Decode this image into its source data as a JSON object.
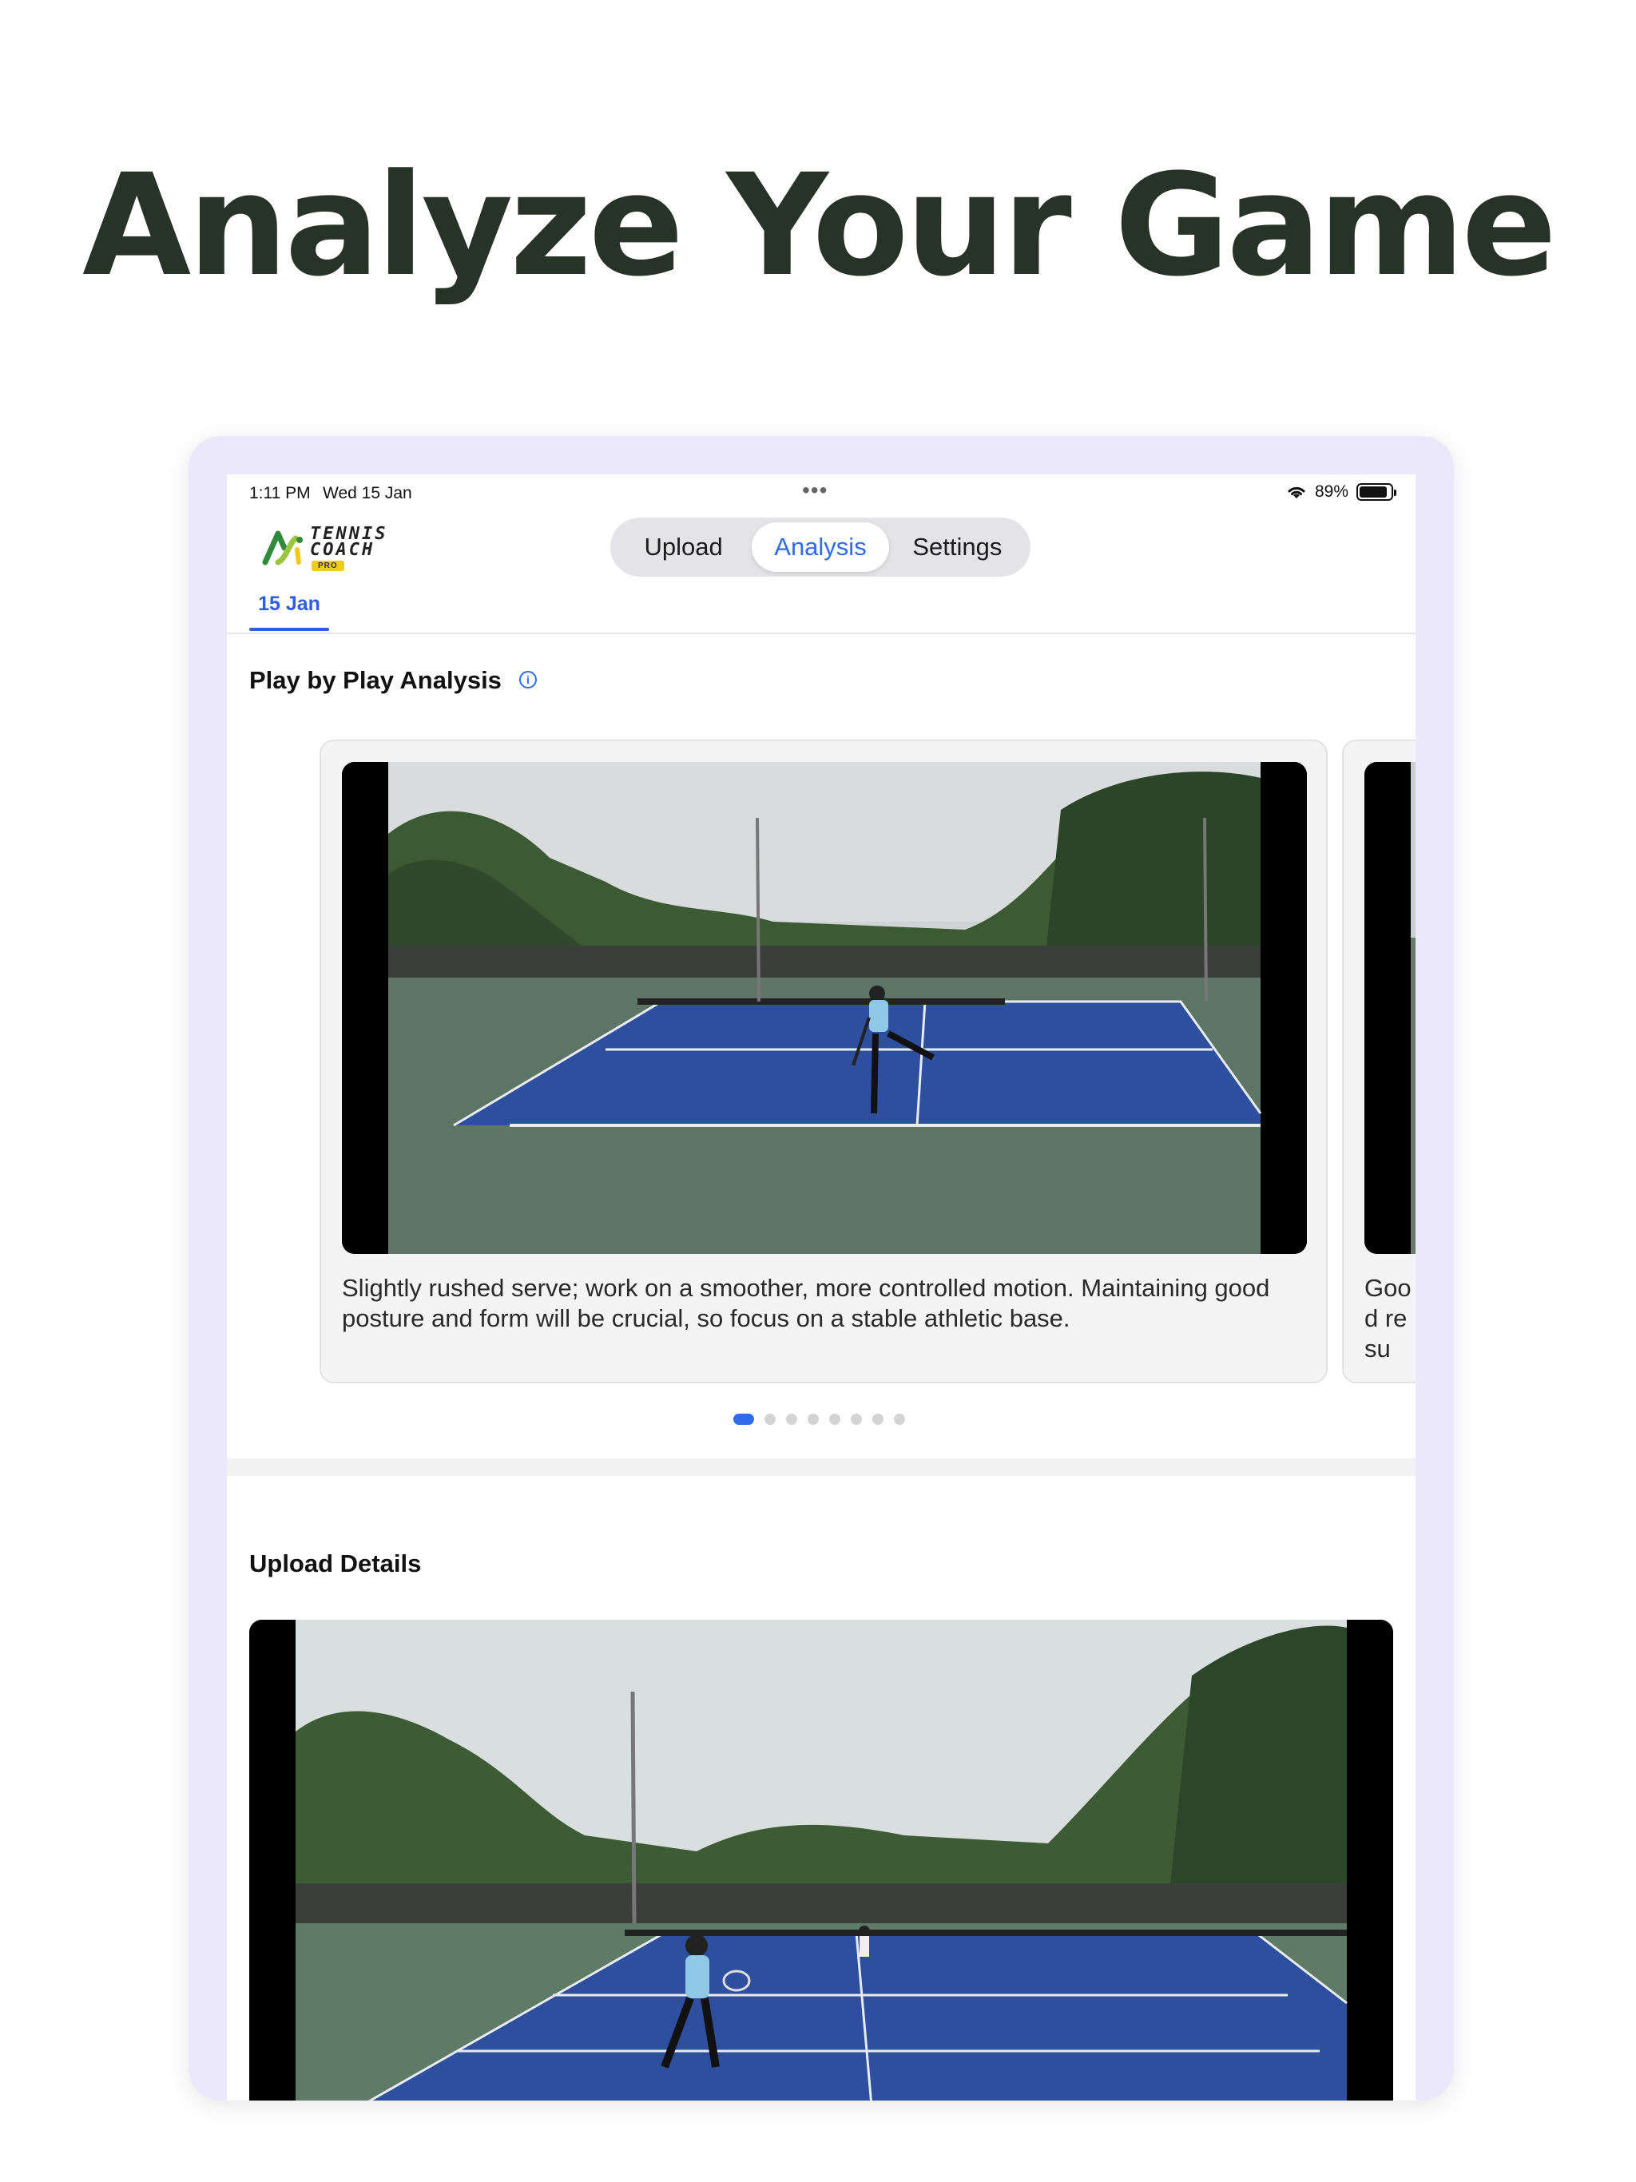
{
  "headline": "Analyze Your Game",
  "status_bar": {
    "time": "1:11 PM",
    "date": "Wed 15 Jan",
    "battery_percent": "89%",
    "battery_level": 0.89
  },
  "logo": {
    "line1": "TENNIS",
    "line2": "COACH",
    "badge": "PRO"
  },
  "nav": {
    "tabs": [
      "Upload",
      "Analysis",
      "Settings"
    ],
    "active": "Analysis"
  },
  "date_tab": "15 Jan",
  "play_analysis": {
    "title": "Play by Play Analysis",
    "cards": [
      {
        "caption": "Slightly rushed serve; work on a smoother, more controlled motion. Maintaining good posture and form will be crucial, so focus on a stable athletic base."
      },
      {
        "caption": "Good resu"
      }
    ],
    "page_count": 8,
    "current_page": 1
  },
  "upload_details": {
    "title": "Upload Details"
  },
  "colors": {
    "accent": "#2f6bea",
    "headline": "#283327",
    "device_frame": "#ebe8fb",
    "court_blue": "#2e4f9e",
    "court_green": "#5c7565"
  },
  "icons": {
    "info": "info-circle-icon",
    "wifi": "wifi-icon",
    "battery": "battery-icon",
    "more": "more-dots-icon"
  }
}
